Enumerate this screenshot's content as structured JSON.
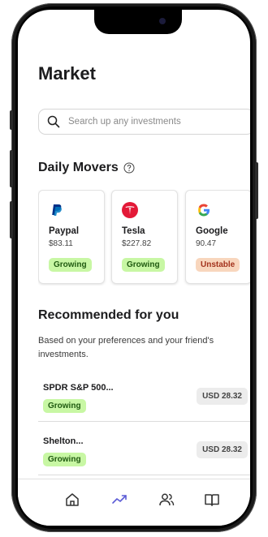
{
  "page": {
    "title": "Market"
  },
  "search": {
    "placeholder": "Search up any investments"
  },
  "daily_movers": {
    "heading": "Daily Movers",
    "cards": [
      {
        "name": "Paypal",
        "price": "$83.11",
        "status": "Growing",
        "logo": "paypal-logo"
      },
      {
        "name": "Tesla",
        "price": "$227.82",
        "status": "Growing",
        "logo": "tesla-logo"
      },
      {
        "name": "Google",
        "price": "90.47",
        "status": "Unstable",
        "logo": "google-logo"
      }
    ]
  },
  "recommended": {
    "heading": "Recommended for you",
    "description": "Based on your preferences and your friend's investments.",
    "items": [
      {
        "name": "SPDR S&P 500...",
        "status": "Growing",
        "amount": "USD 28.32"
      },
      {
        "name": "Shelton...",
        "status": "Growing",
        "amount": "USD 28.32"
      }
    ]
  },
  "tabbar": {
    "tabs": [
      {
        "icon": "home-icon"
      },
      {
        "icon": "trending-icon",
        "active": true
      },
      {
        "icon": "users-icon"
      },
      {
        "icon": "book-icon"
      }
    ]
  },
  "colors": {
    "accent": "#5b5bd6",
    "growing_bg": "#c8f7a4",
    "unstable_bg": "#f8d6bd",
    "paypal": "#003087",
    "tesla": "#e31937"
  }
}
